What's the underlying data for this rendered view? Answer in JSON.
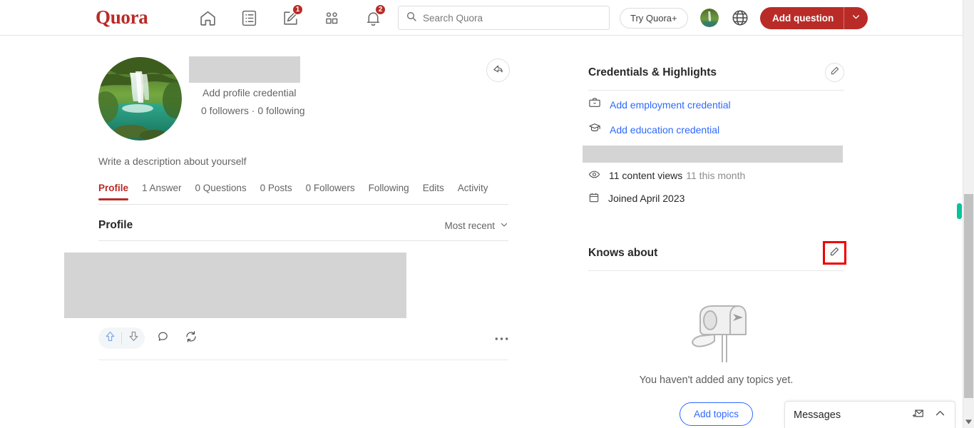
{
  "header": {
    "logo": "Quora",
    "nav": [
      {
        "name": "home-icon",
        "badge": null
      },
      {
        "name": "answer-icon",
        "badge": null
      },
      {
        "name": "write-icon",
        "badge": "1"
      },
      {
        "name": "spaces-icon",
        "badge": null
      },
      {
        "name": "notifications-icon",
        "badge": "2"
      }
    ],
    "search": {
      "placeholder": "Search Quora",
      "value": ""
    },
    "try_quora_plus": "Try Quora+",
    "language_icon": "globe-icon",
    "add_question": "Add question"
  },
  "profile": {
    "name_redacted": true,
    "credential_placeholder": "Add profile credential",
    "followers_line": "0 followers · 0 following",
    "description_placeholder": "Write a description about yourself",
    "share_icon": "share-icon",
    "tabs": [
      {
        "label": "Profile",
        "active": true
      },
      {
        "label": "1 Answer",
        "active": false
      },
      {
        "label": "0 Questions",
        "active": false
      },
      {
        "label": "0 Posts",
        "active": false
      },
      {
        "label": "0 Followers",
        "active": false
      },
      {
        "label": "Following",
        "active": false
      },
      {
        "label": "Edits",
        "active": false
      },
      {
        "label": "Activity",
        "active": false
      }
    ],
    "section_title": "Profile",
    "sort_label": "Most recent",
    "post_actions": {
      "upvote_icon": "upvote-arrow-icon",
      "downvote_icon": "downvote-arrow-icon",
      "comment_icon": "comment-bubble-icon",
      "share_icon": "repost-icon",
      "more_icon": "more-dots-icon"
    }
  },
  "sidebar": {
    "credentials_title": "Credentials & Highlights",
    "edit_icon": "pencil-edit-icon",
    "links": [
      {
        "label": "Add employment credential",
        "icon": "briefcase-icon"
      },
      {
        "label": "Add education credential",
        "icon": "graduation-cap-icon"
      }
    ],
    "stats": [
      {
        "icon": "eye-icon",
        "label": "11 content views",
        "muted": "11 this month"
      },
      {
        "icon": "calendar-icon",
        "label": "Joined April 2023",
        "muted": ""
      }
    ],
    "knows_about_title": "Knows about",
    "knows_about_edit_icon": "pencil-edit-icon",
    "empty_illustration": "mailbox-icon",
    "empty_text": "You haven't added any topics yet.",
    "add_topics": "Add topics"
  },
  "messages_dock": {
    "label": "Messages",
    "compose_icon": "new-message-icon",
    "collapse_icon": "chevron-up-icon"
  },
  "colors": {
    "brand_red": "#b92b27",
    "link_blue": "#2e69ff",
    "highlight_red": "#ee0000",
    "marker_green": "#08c29a"
  }
}
